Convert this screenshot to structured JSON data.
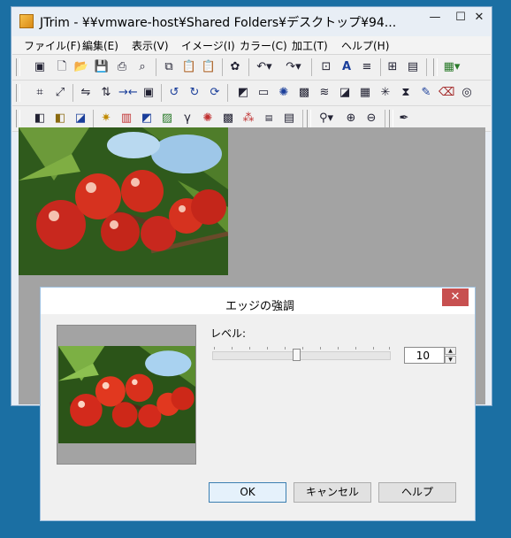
{
  "window": {
    "title": "JTrim - ¥¥vmware-host¥Shared Folders¥デスクトップ¥94...",
    "min_glyph": "—",
    "max_glyph": "☐",
    "close_glyph": "✕"
  },
  "menu": [
    {
      "label": "ファイル(F)"
    },
    {
      "label": "編集(E)"
    },
    {
      "label": "表示(V)"
    },
    {
      "label": "イメージ(I)"
    },
    {
      "label": "カラー(C)"
    },
    {
      "label": "加工(T)"
    },
    {
      "label": "ヘルプ(H)"
    }
  ],
  "toolbar_icons": {
    "row1": [
      "new-window-icon",
      "new-file-icon",
      "open-folder-icon",
      "save-icon",
      "print-icon",
      "print-preview-icon",
      "copy-icon",
      "paste-icon",
      "paste-new-icon",
      "stamp-icon",
      "undo-icon",
      "redo-icon",
      "fit-icon",
      "text-icon",
      "align-icon",
      "grid-icon",
      "filmstrip-icon",
      "palette-icon"
    ],
    "row2": [
      "crop-icon",
      "resize-icon",
      "flip-horizontal-icon",
      "flip-vertical-icon",
      "join-icon",
      "frame-icon",
      "rotate-left-icon",
      "rotate-right-icon",
      "rotate-icon",
      "shadow-icon",
      "emboss-icon",
      "blur-icon",
      "mosaic-icon",
      "wave-icon",
      "sharpen-icon",
      "noise-icon",
      "spot-icon",
      "edge-icon",
      "pencil-icon",
      "eraser-icon",
      "swirl-icon"
    ],
    "row3": [
      "grayscale-icon",
      "sepia-icon",
      "invert-icon",
      "sparkle-icon",
      "color-bars-icon",
      "gradient-icon",
      "picture-icon",
      "gamma-icon",
      "color-wheel-icon",
      "checker-icon",
      "rgb-icon",
      "xor-icon",
      "histogram-icon",
      "zoom-icon",
      "zoom-in-icon",
      "zoom-out-icon",
      "eyedropper-icon"
    ]
  },
  "dialog": {
    "title": "エッジの強調",
    "close_glyph": "✕",
    "level_label": "レベル:",
    "level_value": "10",
    "slider_fraction": 0.47,
    "ok_label": "OK",
    "cancel_label": "キャンセル",
    "help_label": "ヘルプ"
  }
}
